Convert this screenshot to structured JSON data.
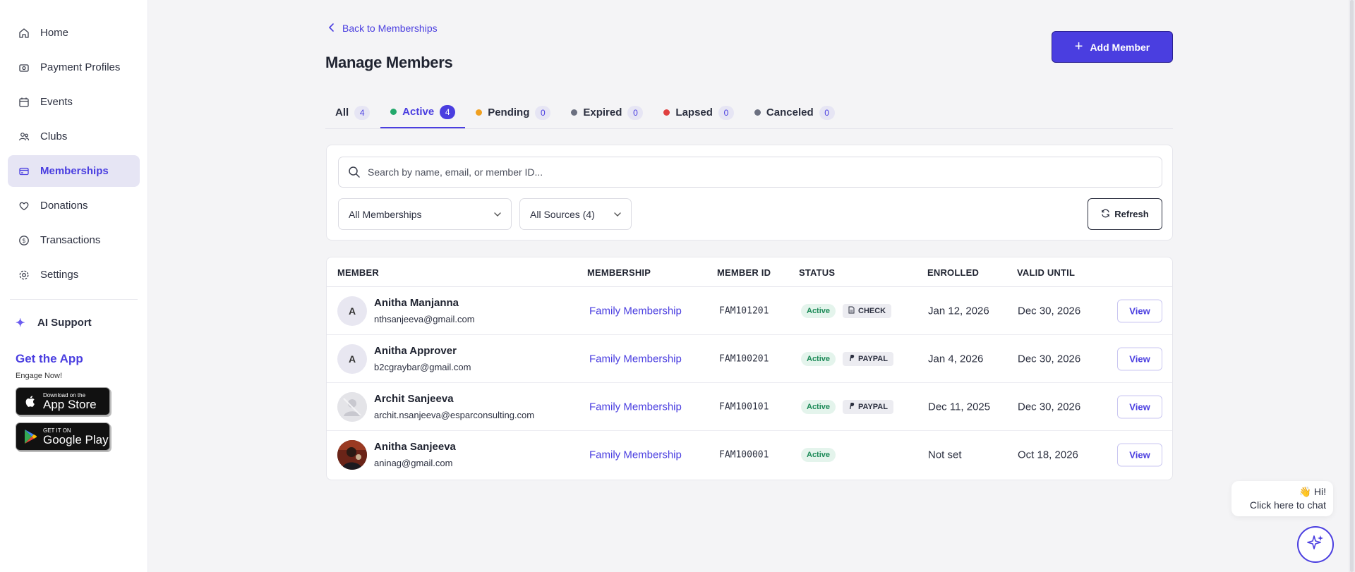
{
  "sidebar": {
    "items": [
      {
        "label": "Home",
        "icon": "home-icon"
      },
      {
        "label": "Payment Profiles",
        "icon": "payment-profile-icon"
      },
      {
        "label": "Events",
        "icon": "calendar-icon"
      },
      {
        "label": "Clubs",
        "icon": "people-icon"
      },
      {
        "label": "Memberships",
        "icon": "card-icon",
        "active": true
      },
      {
        "label": "Donations",
        "icon": "heart-icon"
      },
      {
        "label": "Transactions",
        "icon": "dollar-icon"
      },
      {
        "label": "Settings",
        "icon": "gear-icon"
      }
    ],
    "ai_support": "AI Support",
    "get_app_title": "Get the App",
    "get_app_sub": "Engage Now!",
    "app_store_small": "Download on the",
    "app_store_big": "App Store",
    "google_play_small": "GET IT ON",
    "google_play_big": "Google Play"
  },
  "header": {
    "back_label": "Back to Memberships",
    "title": "Manage Members",
    "add_label": "Add Member"
  },
  "tabs": [
    {
      "label": "All",
      "count": "4",
      "dot": ""
    },
    {
      "label": "Active",
      "count": "4",
      "dot": "#22a86b",
      "active": true
    },
    {
      "label": "Pending",
      "count": "0",
      "dot": "#f0a020"
    },
    {
      "label": "Expired",
      "count": "0",
      "dot": "#6b7080"
    },
    {
      "label": "Lapsed",
      "count": "0",
      "dot": "#e04040"
    },
    {
      "label": "Canceled",
      "count": "0",
      "dot": "#6b7080"
    }
  ],
  "filters": {
    "search_placeholder": "Search by name, email, or member ID...",
    "membership_select": "All Memberships",
    "source_select": "All Sources (4)",
    "refresh_label": "Refresh"
  },
  "table": {
    "headers": {
      "member": "MEMBER",
      "membership": "MEMBERSHIP",
      "member_id": "MEMBER ID",
      "status": "STATUS",
      "enrolled": "ENROLLED",
      "valid_until": "VALID UNTIL"
    },
    "rows": [
      {
        "initial": "A",
        "name": "Anitha Manjanna",
        "email": "nthsanjeeva@gmail.com",
        "membership": "Family Membership",
        "member_id": "FAM101201",
        "status": "Active",
        "source": "CHECK",
        "enrolled": "Jan 12, 2026",
        "valid_until": "Dec 30, 2026",
        "view": "View"
      },
      {
        "initial": "A",
        "name": "Anitha Approver",
        "email": "b2cgraybar@gmail.com",
        "membership": "Family Membership",
        "member_id": "FAM100201",
        "status": "Active",
        "source": "PAYPAL",
        "enrolled": "Jan 4, 2026",
        "valid_until": "Dec 30, 2026",
        "view": "View"
      },
      {
        "initial": "",
        "name": "Archit Sanjeeva",
        "email": "archit.nsanjeeva@esparconsulting.com",
        "membership": "Family Membership",
        "member_id": "FAM100101",
        "status": "Active",
        "source": "PAYPAL",
        "enrolled": "Dec 11, 2025",
        "valid_until": "Dec 30, 2026",
        "view": "View"
      },
      {
        "initial": "",
        "name": "Anitha Sanjeeva",
        "email": "aninag@gmail.com",
        "membership": "Family Membership",
        "member_id": "FAM100001",
        "status": "Active",
        "source": "",
        "enrolled": "Not set",
        "valid_until": "Oct 18, 2026",
        "view": "View"
      }
    ]
  },
  "chat": {
    "greeting": "👋 Hi!",
    "prompt": "Click here to chat"
  },
  "colors": {
    "accent": "#4a3ee0",
    "active_status": "#1c8a57"
  }
}
